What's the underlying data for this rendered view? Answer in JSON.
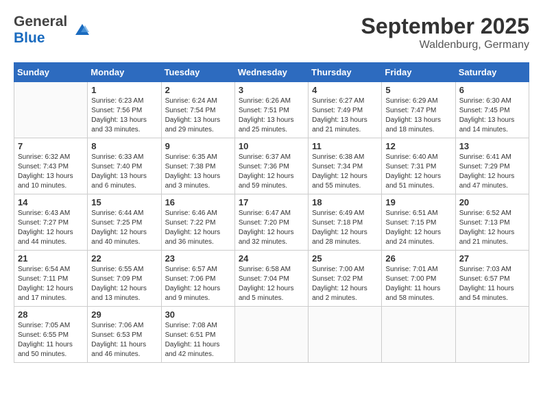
{
  "header": {
    "logo_line1": "General",
    "logo_line2": "Blue",
    "month": "September 2025",
    "location": "Waldenburg, Germany"
  },
  "weekdays": [
    "Sunday",
    "Monday",
    "Tuesday",
    "Wednesday",
    "Thursday",
    "Friday",
    "Saturday"
  ],
  "weeks": [
    [
      {
        "day": "",
        "sunrise": "",
        "sunset": "",
        "daylight": ""
      },
      {
        "day": "1",
        "sunrise": "Sunrise: 6:23 AM",
        "sunset": "Sunset: 7:56 PM",
        "daylight": "Daylight: 13 hours and 33 minutes."
      },
      {
        "day": "2",
        "sunrise": "Sunrise: 6:24 AM",
        "sunset": "Sunset: 7:54 PM",
        "daylight": "Daylight: 13 hours and 29 minutes."
      },
      {
        "day": "3",
        "sunrise": "Sunrise: 6:26 AM",
        "sunset": "Sunset: 7:51 PM",
        "daylight": "Daylight: 13 hours and 25 minutes."
      },
      {
        "day": "4",
        "sunrise": "Sunrise: 6:27 AM",
        "sunset": "Sunset: 7:49 PM",
        "daylight": "Daylight: 13 hours and 21 minutes."
      },
      {
        "day": "5",
        "sunrise": "Sunrise: 6:29 AM",
        "sunset": "Sunset: 7:47 PM",
        "daylight": "Daylight: 13 hours and 18 minutes."
      },
      {
        "day": "6",
        "sunrise": "Sunrise: 6:30 AM",
        "sunset": "Sunset: 7:45 PM",
        "daylight": "Daylight: 13 hours and 14 minutes."
      }
    ],
    [
      {
        "day": "7",
        "sunrise": "Sunrise: 6:32 AM",
        "sunset": "Sunset: 7:43 PM",
        "daylight": "Daylight: 13 hours and 10 minutes."
      },
      {
        "day": "8",
        "sunrise": "Sunrise: 6:33 AM",
        "sunset": "Sunset: 7:40 PM",
        "daylight": "Daylight: 13 hours and 6 minutes."
      },
      {
        "day": "9",
        "sunrise": "Sunrise: 6:35 AM",
        "sunset": "Sunset: 7:38 PM",
        "daylight": "Daylight: 13 hours and 3 minutes."
      },
      {
        "day": "10",
        "sunrise": "Sunrise: 6:37 AM",
        "sunset": "Sunset: 7:36 PM",
        "daylight": "Daylight: 12 hours and 59 minutes."
      },
      {
        "day": "11",
        "sunrise": "Sunrise: 6:38 AM",
        "sunset": "Sunset: 7:34 PM",
        "daylight": "Daylight: 12 hours and 55 minutes."
      },
      {
        "day": "12",
        "sunrise": "Sunrise: 6:40 AM",
        "sunset": "Sunset: 7:31 PM",
        "daylight": "Daylight: 12 hours and 51 minutes."
      },
      {
        "day": "13",
        "sunrise": "Sunrise: 6:41 AM",
        "sunset": "Sunset: 7:29 PM",
        "daylight": "Daylight: 12 hours and 47 minutes."
      }
    ],
    [
      {
        "day": "14",
        "sunrise": "Sunrise: 6:43 AM",
        "sunset": "Sunset: 7:27 PM",
        "daylight": "Daylight: 12 hours and 44 minutes."
      },
      {
        "day": "15",
        "sunrise": "Sunrise: 6:44 AM",
        "sunset": "Sunset: 7:25 PM",
        "daylight": "Daylight: 12 hours and 40 minutes."
      },
      {
        "day": "16",
        "sunrise": "Sunrise: 6:46 AM",
        "sunset": "Sunset: 7:22 PM",
        "daylight": "Daylight: 12 hours and 36 minutes."
      },
      {
        "day": "17",
        "sunrise": "Sunrise: 6:47 AM",
        "sunset": "Sunset: 7:20 PM",
        "daylight": "Daylight: 12 hours and 32 minutes."
      },
      {
        "day": "18",
        "sunrise": "Sunrise: 6:49 AM",
        "sunset": "Sunset: 7:18 PM",
        "daylight": "Daylight: 12 hours and 28 minutes."
      },
      {
        "day": "19",
        "sunrise": "Sunrise: 6:51 AM",
        "sunset": "Sunset: 7:15 PM",
        "daylight": "Daylight: 12 hours and 24 minutes."
      },
      {
        "day": "20",
        "sunrise": "Sunrise: 6:52 AM",
        "sunset": "Sunset: 7:13 PM",
        "daylight": "Daylight: 12 hours and 21 minutes."
      }
    ],
    [
      {
        "day": "21",
        "sunrise": "Sunrise: 6:54 AM",
        "sunset": "Sunset: 7:11 PM",
        "daylight": "Daylight: 12 hours and 17 minutes."
      },
      {
        "day": "22",
        "sunrise": "Sunrise: 6:55 AM",
        "sunset": "Sunset: 7:09 PM",
        "daylight": "Daylight: 12 hours and 13 minutes."
      },
      {
        "day": "23",
        "sunrise": "Sunrise: 6:57 AM",
        "sunset": "Sunset: 7:06 PM",
        "daylight": "Daylight: 12 hours and 9 minutes."
      },
      {
        "day": "24",
        "sunrise": "Sunrise: 6:58 AM",
        "sunset": "Sunset: 7:04 PM",
        "daylight": "Daylight: 12 hours and 5 minutes."
      },
      {
        "day": "25",
        "sunrise": "Sunrise: 7:00 AM",
        "sunset": "Sunset: 7:02 PM",
        "daylight": "Daylight: 12 hours and 2 minutes."
      },
      {
        "day": "26",
        "sunrise": "Sunrise: 7:01 AM",
        "sunset": "Sunset: 7:00 PM",
        "daylight": "Daylight: 11 hours and 58 minutes."
      },
      {
        "day": "27",
        "sunrise": "Sunrise: 7:03 AM",
        "sunset": "Sunset: 6:57 PM",
        "daylight": "Daylight: 11 hours and 54 minutes."
      }
    ],
    [
      {
        "day": "28",
        "sunrise": "Sunrise: 7:05 AM",
        "sunset": "Sunset: 6:55 PM",
        "daylight": "Daylight: 11 hours and 50 minutes."
      },
      {
        "day": "29",
        "sunrise": "Sunrise: 7:06 AM",
        "sunset": "Sunset: 6:53 PM",
        "daylight": "Daylight: 11 hours and 46 minutes."
      },
      {
        "day": "30",
        "sunrise": "Sunrise: 7:08 AM",
        "sunset": "Sunset: 6:51 PM",
        "daylight": "Daylight: 11 hours and 42 minutes."
      },
      {
        "day": "",
        "sunrise": "",
        "sunset": "",
        "daylight": ""
      },
      {
        "day": "",
        "sunrise": "",
        "sunset": "",
        "daylight": ""
      },
      {
        "day": "",
        "sunrise": "",
        "sunset": "",
        "daylight": ""
      },
      {
        "day": "",
        "sunrise": "",
        "sunset": "",
        "daylight": ""
      }
    ]
  ]
}
